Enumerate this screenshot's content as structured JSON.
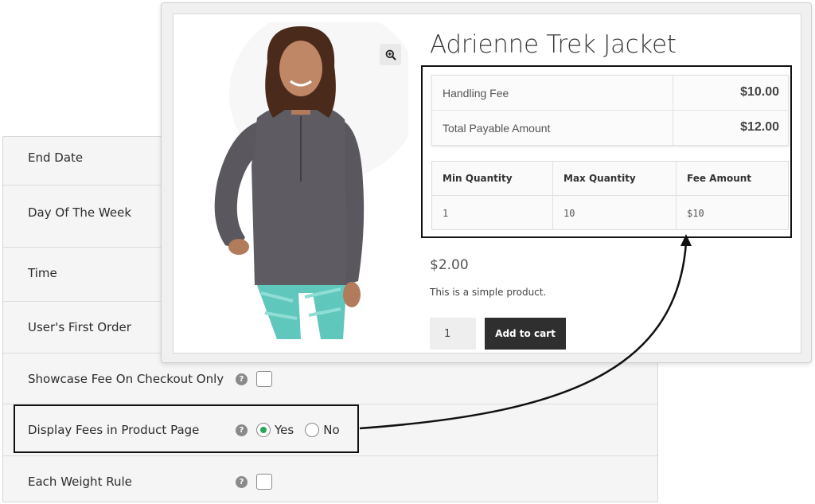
{
  "settings": {
    "rows": [
      {
        "label": "End Date"
      },
      {
        "label": "Day Of The Week"
      },
      {
        "label": "Time"
      },
      {
        "label": "User's First Order"
      },
      {
        "label": "Showcase Fee On Checkout Only",
        "help": "?"
      },
      {
        "label": "Display Fees in Product Page",
        "help": "?",
        "options": [
          "Yes",
          "No"
        ],
        "selected": "Yes"
      },
      {
        "label": "Each Weight Rule",
        "help": "?"
      }
    ]
  },
  "product": {
    "title": "Adrienne Trek Jacket",
    "fees": [
      {
        "label": "Handling Fee",
        "value": "$10.00"
      },
      {
        "label": "Total Payable Amount",
        "value": "$12.00"
      }
    ],
    "qty_table": {
      "headers": [
        "Min Quantity",
        "Max Quantity",
        "Fee Amount"
      ],
      "row": [
        "1",
        "10",
        "$10"
      ]
    },
    "price": "$2.00",
    "description": "This is a simple product.",
    "quantity": "1",
    "add_to_cart": "Add to cart"
  },
  "colors": {
    "radio_selected": "#2aa65a",
    "button_dark": "#2f2f2f",
    "highlight_border": "#111111"
  },
  "icons": {
    "zoom": "zoom-in-icon",
    "help": "help-icon"
  }
}
